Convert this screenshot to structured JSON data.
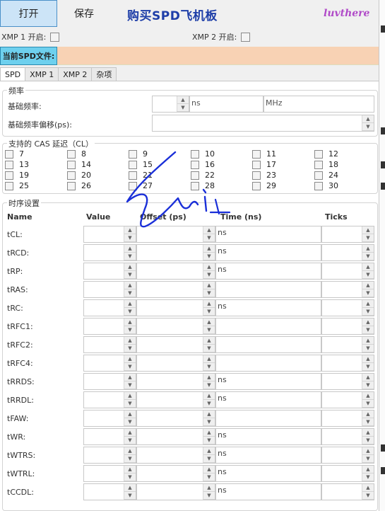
{
  "toolbar": {
    "open_label": "打开",
    "save_label": "保存"
  },
  "promo": {
    "buy_label": "购买SPD飞机板",
    "author": "luvthere"
  },
  "xmp": {
    "xmp1_label": "XMP 1 开启:",
    "xmp2_label": "XMP 2 开启:"
  },
  "file": {
    "current_label": "当前SPD文件:",
    "value": ""
  },
  "tabs": [
    {
      "label": "SPD"
    },
    {
      "label": "XMP 1"
    },
    {
      "label": "XMP 2"
    },
    {
      "label": "杂项"
    }
  ],
  "frequency": {
    "group_title": "频率",
    "base_label": "基础频率:",
    "base_unit_ns": "ns",
    "base_unit_mhz": "MHz",
    "offset_label": "基础频率偏移(ps):"
  },
  "cas": {
    "group_title": "支持的 CAS 延迟（CL）",
    "values": [
      "7",
      "8",
      "9",
      "10",
      "11",
      "12",
      "13",
      "14",
      "15",
      "16",
      "17",
      "18",
      "19",
      "20",
      "21",
      "22",
      "23",
      "24",
      "25",
      "26",
      "27",
      "28",
      "29",
      "30"
    ]
  },
  "timing": {
    "group_title": "时序设置",
    "headers": {
      "name": "Name",
      "value": "Value",
      "offset": "Offset (ps)",
      "time": "Time (ns)",
      "ticks": "Ticks"
    },
    "rows": [
      {
        "name": "tCL:",
        "time": "ns"
      },
      {
        "name": "tRCD:",
        "time": "ns"
      },
      {
        "name": "tRP:",
        "time": "ns"
      },
      {
        "name": "tRAS:",
        "time": ""
      },
      {
        "name": "tRC:",
        "time": "ns"
      },
      {
        "name": "tRFC1:",
        "time": ""
      },
      {
        "name": "tRFC2:",
        "time": ""
      },
      {
        "name": "tRFC4:",
        "time": ""
      },
      {
        "name": "tRRDS:",
        "time": "ns"
      },
      {
        "name": "tRRDL:",
        "time": "ns"
      },
      {
        "name": "tFAW:",
        "time": ""
      },
      {
        "name": "tWR:",
        "time": "ns"
      },
      {
        "name": "tWTRS:",
        "time": "ns"
      },
      {
        "name": "tWTRL:",
        "time": "ns"
      },
      {
        "name": "tCCDL:",
        "time": "ns"
      }
    ]
  },
  "colors": {
    "accent": "#1e3ea8",
    "author": "#b04ac8",
    "file_bar": "#f8d2b4",
    "file_label": "#6ed0ee",
    "ink": "#1a2fd8"
  }
}
